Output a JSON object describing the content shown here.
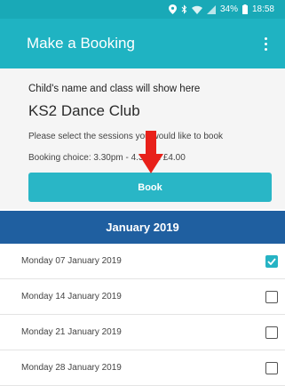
{
  "status_bar": {
    "battery": "34%",
    "time": "18:58",
    "icons": [
      "location-icon",
      "bluetooth-icon",
      "wifi-icon",
      "signal-icon",
      "battery-icon"
    ]
  },
  "app_bar": {
    "title": "Make a Booking",
    "menu_icon": "more-vert-icon"
  },
  "card": {
    "child_name_text": "Child's name and class will show here",
    "club_title": "KS2 Dance Club",
    "instruction": "Please select the sessions you would like to book",
    "booking_choice": "Booking choice: 3.30pm - 4.30pm £4.00",
    "book_label": "Book"
  },
  "month_header": "January 2019",
  "dates": [
    {
      "label": "Monday 07 January 2019",
      "checked": true
    },
    {
      "label": "Monday 14 January 2019",
      "checked": false
    },
    {
      "label": "Monday 21 January 2019",
      "checked": false
    },
    {
      "label": "Monday 28 January 2019",
      "checked": false
    }
  ],
  "colors": {
    "accent": "#1fb3c2",
    "month_header": "#1f5fa0",
    "arrow": "#e8201a"
  }
}
